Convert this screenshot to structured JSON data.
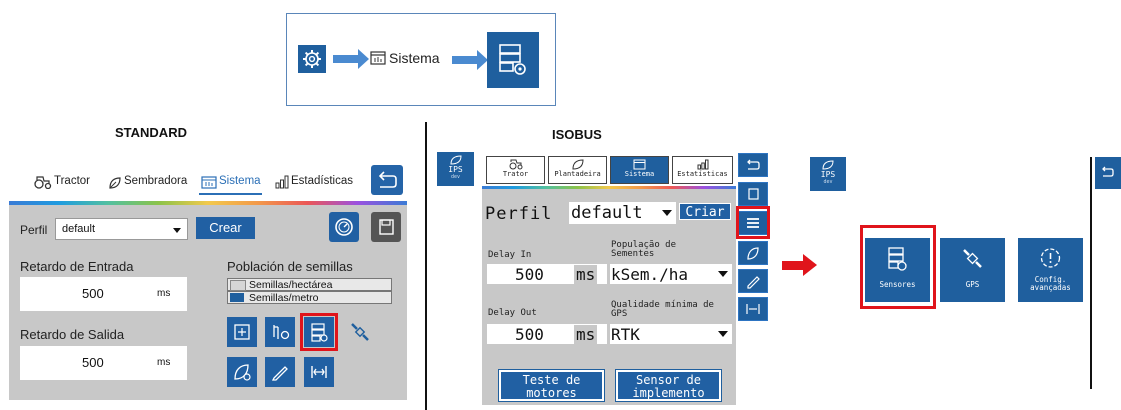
{
  "flow": {
    "label": "Sistema"
  },
  "standard": {
    "heading": "STANDARD",
    "tabs": [
      "Tractor",
      "Sembradora",
      "Sistema",
      "Estadísticas"
    ],
    "perfil_label": "Perfil",
    "perfil_value": "default",
    "crear_label": "Crear",
    "retardo_entrada_label": "Retardo de Entrada",
    "retardo_entrada_value": "500",
    "retardo_entrada_unit": "ms",
    "retardo_salida_label": "Retardo de Salida",
    "retardo_salida_value": "500",
    "retardo_salida_unit": "ms",
    "poblacion_label": "Población de semillas",
    "poblacion_options": [
      "Semillas/hectárea",
      "Semillas/metro"
    ]
  },
  "isobus": {
    "heading": "ISOBUS",
    "ips_label": "IPS",
    "ips_sub": "dev",
    "tabs": [
      "Trator",
      "Plantadeira",
      "Sistema",
      "Estatísticas"
    ],
    "perfil_label": "Perfil",
    "perfil_value": "default",
    "criar_label": "Criar",
    "delay_in_label": "Delay In",
    "delay_in_value": "500",
    "delay_in_unit": "ms",
    "populacao_label": "População de Sementes",
    "populacao_value": "kSem./ha",
    "delay_out_label": "Delay Out",
    "delay_out_value": "500",
    "delay_out_unit": "ms",
    "qualidade_label": "Qualidade mínima de GPS",
    "qualidade_value": "RTK",
    "teste_label_1": "Teste de",
    "teste_label_2": "motores",
    "sensor_label_1": "Sensor de",
    "sensor_label_2": "implemento"
  },
  "right": {
    "ips_label": "IPS",
    "ips_sub": "dev",
    "tiles": [
      "Sensores",
      "GPS",
      "Config.",
      "avançadas"
    ]
  }
}
